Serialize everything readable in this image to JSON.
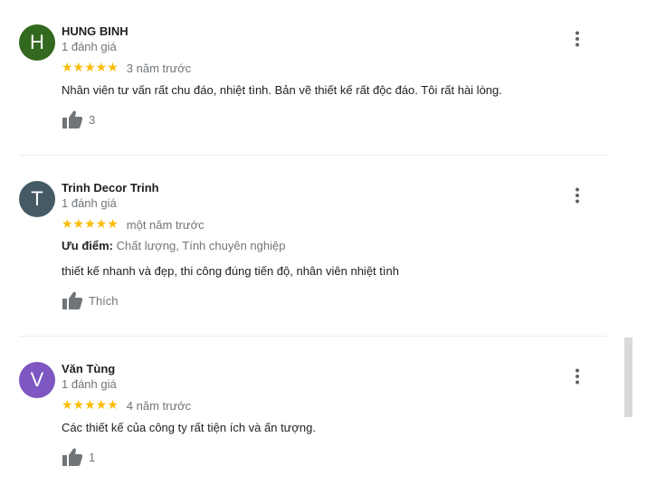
{
  "reviews": [
    {
      "avatar_letter": "H",
      "avatar_color": "#33691e",
      "name": "HUNG BINH",
      "review_count": "1 đánh giá",
      "stars": "★★★★★",
      "rating": 5,
      "date": "3 năm trước",
      "pros_label": "",
      "pros_value": "",
      "text": "Nhân viên tư vấn rất chu đáo, nhiệt tình. Bản vẽ thiết kế rất độc đáo. Tôi rất hài lòng.",
      "like_label": "3"
    },
    {
      "avatar_letter": "T",
      "avatar_color": "#455a64",
      "name": "Trinh Decor Trinh",
      "review_count": "1 đánh giá",
      "stars": "★★★★★",
      "rating": 5,
      "date": "một năm trước",
      "pros_label": "Ưu điểm:",
      "pros_value": "Chất lượng, Tính chuyên nghiệp",
      "text": "thiết kế nhanh và đẹp, thi công đúng tiến độ, nhân viên nhiệt tình",
      "like_label": "Thích"
    },
    {
      "avatar_letter": "V",
      "avatar_color": "#7e57c2",
      "name": "Văn Tùng",
      "review_count": "1 đánh giá",
      "stars": "★★★★★",
      "rating": 5,
      "date": "4 năm trước",
      "pros_label": "",
      "pros_value": "",
      "text": "Các thiết kế của công ty rất tiện ích và ấn tượng.",
      "like_label": "1"
    }
  ],
  "icons": {
    "like": "thumbs-up-icon",
    "more": "more-vertical-icon"
  },
  "colors": {
    "star": "#fbbc04",
    "secondary_text": "#70757a",
    "icon": "#70757a"
  }
}
